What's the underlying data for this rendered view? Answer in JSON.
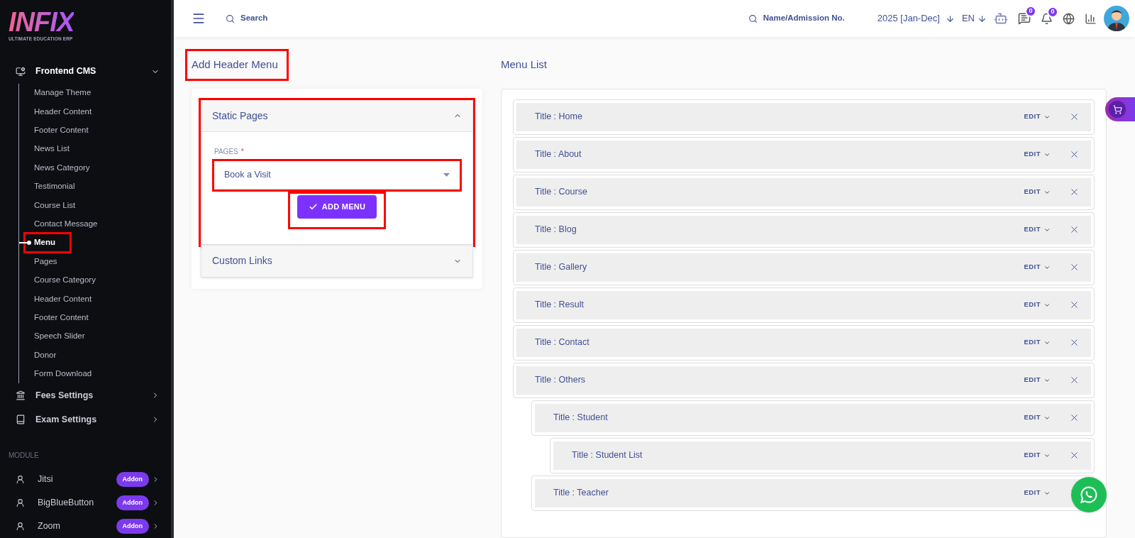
{
  "logo": {
    "text": "INFIX",
    "tagline": "ULTIMATE EDUCATION ERP"
  },
  "sidebar": {
    "groups": [
      {
        "label": "Frontend CMS",
        "expanded": true,
        "children": [
          {
            "label": "Manage Theme",
            "selected": false,
            "annotated": false
          },
          {
            "label": "Header Content",
            "selected": false,
            "annotated": false
          },
          {
            "label": "Footer Content",
            "selected": false,
            "annotated": false
          },
          {
            "label": "News List",
            "selected": false,
            "annotated": false
          },
          {
            "label": "News Category",
            "selected": false,
            "annotated": false
          },
          {
            "label": "Testimonial",
            "selected": false,
            "annotated": false
          },
          {
            "label": "Course List",
            "selected": false,
            "annotated": false
          },
          {
            "label": "Contact Message",
            "selected": false,
            "annotated": false
          },
          {
            "label": "Menu",
            "selected": true,
            "annotated": true
          },
          {
            "label": "Pages",
            "selected": false,
            "annotated": false
          },
          {
            "label": "Course Category",
            "selected": false,
            "annotated": false
          },
          {
            "label": "Header Content",
            "selected": false,
            "annotated": false
          },
          {
            "label": "Footer Content",
            "selected": false,
            "annotated": false
          },
          {
            "label": "Speech Slider",
            "selected": false,
            "annotated": false
          },
          {
            "label": "Donor",
            "selected": false,
            "annotated": false
          },
          {
            "label": "Form Download",
            "selected": false,
            "annotated": false
          }
        ]
      },
      {
        "label": "Fees Settings",
        "expanded": false
      },
      {
        "label": "Exam Settings",
        "expanded": false
      }
    ],
    "section": "MODULE",
    "modules": [
      {
        "label": "Jitsi",
        "badge": "Addon"
      },
      {
        "label": "BigBlueButton",
        "badge": "Addon"
      },
      {
        "label": "Zoom",
        "badge": "Addon"
      }
    ]
  },
  "topbar": {
    "search_placeholder": "Search",
    "admission_search_placeholder": "Name/Admission No.",
    "session": "2025 [Jan-Dec]",
    "language": "EN",
    "messages_count": "0",
    "notifications_count": "0"
  },
  "add_header_menu": {
    "title": "Add Header Menu",
    "title_annotated": true,
    "sections": [
      {
        "title": "Static Pages",
        "expanded": true,
        "annotated": true,
        "field_label": "PAGES",
        "required_mark": "*",
        "value": "Book a Visit",
        "field_annotated": true,
        "button": "ADD MENU",
        "button_annotated": true
      },
      {
        "title": "Custom Links",
        "expanded": false,
        "annotated": false
      }
    ]
  },
  "menu_list": {
    "title": "Menu List",
    "items": [
      {
        "title": "Title : Home",
        "edit": "EDIT"
      },
      {
        "title": "Title : About",
        "edit": "EDIT"
      },
      {
        "title": "Title : Course",
        "edit": "EDIT"
      },
      {
        "title": "Title : Blog",
        "edit": "EDIT"
      },
      {
        "title": "Title : Gallery",
        "edit": "EDIT"
      },
      {
        "title": "Title : Result",
        "edit": "EDIT"
      },
      {
        "title": "Title : Contact",
        "edit": "EDIT"
      },
      {
        "title": "Title : Others",
        "edit": "EDIT",
        "children": [
          {
            "title": "Title : Student",
            "edit": "EDIT",
            "children": [
              {
                "title": "Title : Student List",
                "edit": "EDIT"
              }
            ]
          },
          {
            "title": "Title : Teacher",
            "edit": "EDIT"
          }
        ]
      }
    ]
  }
}
